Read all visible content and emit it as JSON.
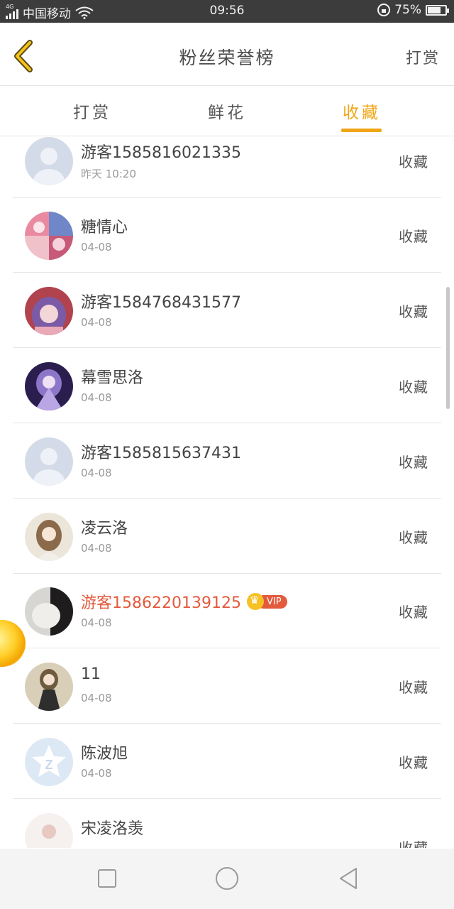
{
  "status_bar": {
    "network_type": "4G",
    "carrier": "中国移动",
    "time": "09:56",
    "battery": "75%",
    "battery_level": 0.75
  },
  "header": {
    "title": "粉丝荣誉榜",
    "action": "打赏",
    "back_icon": "chevron-left-icon"
  },
  "tabs": [
    {
      "label": "打赏",
      "active": false
    },
    {
      "label": "鲜花",
      "active": false
    },
    {
      "label": "收藏",
      "active": true
    }
  ],
  "accent_color": "#f0a516",
  "vip_name_color": "#e35a3c",
  "list": [
    {
      "name": "游客1585816021335",
      "date": "昨天 10:20",
      "action": "收藏",
      "vip": false
    },
    {
      "name": "糖情心",
      "date": "04-08",
      "action": "收藏",
      "vip": false
    },
    {
      "name": "游客1584768431577",
      "date": "04-08",
      "action": "收藏",
      "vip": false
    },
    {
      "name": "幕雪思洛",
      "date": "04-08",
      "action": "收藏",
      "vip": false
    },
    {
      "name": "游客1585815637431",
      "date": "04-08",
      "action": "收藏",
      "vip": false
    },
    {
      "name": "凌云洛",
      "date": "04-08",
      "action": "收藏",
      "vip": false
    },
    {
      "name": "游客1586220139125",
      "date": "04-08",
      "action": "收藏",
      "vip": true,
      "vip_label": "VIP"
    },
    {
      "name": "11",
      "date": "04-08",
      "action": "收藏",
      "vip": false
    },
    {
      "name": "陈波旭",
      "date": "04-08",
      "action": "收藏",
      "vip": false
    },
    {
      "name": "宋凌洛羡",
      "date": "",
      "action": "收藏",
      "vip": false
    }
  ],
  "nav_bar": {
    "recent_icon": "square-icon",
    "home_icon": "circle-icon",
    "back_icon": "triangle-back-icon"
  }
}
